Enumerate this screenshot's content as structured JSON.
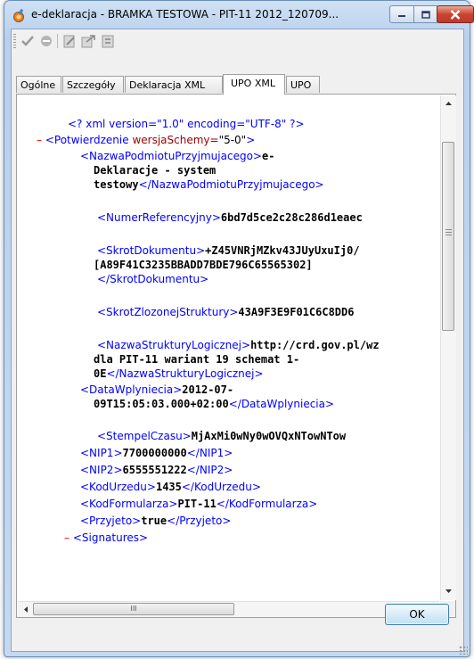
{
  "window": {
    "title": "e-deklaracja - BRAMKA TESTOWA - PIT-11 2012_120709...",
    "controls": {
      "minimize": "minimize",
      "maximize": "maximize",
      "close": "close"
    }
  },
  "toolbar": {
    "icons": [
      "checkmark-icon",
      "no-entry-icon",
      "sign-icon",
      "send-icon",
      "status-icon"
    ]
  },
  "tabs": [
    {
      "label": "Ogólne",
      "active": false
    },
    {
      "label": "Szczegóły",
      "active": false
    },
    {
      "label": "Deklaracja XML",
      "active": false
    },
    {
      "label": "UPO XML",
      "active": true
    },
    {
      "label": "UPO",
      "active": false
    }
  ],
  "xml": {
    "pi": "<? xml version=\"1.0\" encoding=\"UTF-8\" ?>",
    "root_open": "<Potwierdzenie",
    "root_attr_name": " wersjaSchemy=",
    "root_attr_value": "\"5-0\"",
    "root_close_bracket": ">",
    "nazwa_open": "<NazwaPodmiotuPrzyjmujacego>",
    "nazwa_val1": "e-",
    "nazwa_val2": "Deklaracje - system",
    "nazwa_val3": "testowy",
    "nazwa_close": "</NazwaPodmiotuPrzyjmujacego>",
    "numer_open": "<NumerReferencyjny>",
    "numer_val": "6bd7d5ce2c28c286d1eaec",
    "skrot_open": "<SkrotDokumentu>",
    "skrot_val1": "+Z45VNRjMZkv43JUyUxuIj0/",
    "skrot_val2": "[A89F41C3235BBADD7BDE796C65565302]",
    "skrot_close": "</SkrotDokumentu>",
    "skrotz_open": "<SkrotZlozonejStruktury>",
    "skrotz_val": "43A9F3E9F01C6C8DD6",
    "nazwas_open": "<NazwaStrukturyLogicznej>",
    "nazwas_val1": "http://crd.gov.pl/wz",
    "nazwas_val2": "dla PIT-11 wariant 19 schemat 1-",
    "nazwas_val3": "0E",
    "nazwas_close": "</NazwaStrukturyLogicznej>",
    "data_open": "<DataWplyniecia>",
    "data_val1": "2012-07-",
    "data_val2": "09T15:05:03.000+02:00",
    "data_close": "</DataWplyniecia>",
    "stempel_open": "<StempelCzasu>",
    "stempel_val": "MjAxMi0wNy0wOVQxNTowNTow",
    "nip1_open": "<NIP1>",
    "nip1_val": "7700000000",
    "nip1_close": "</NIP1>",
    "nip2_open": "<NIP2>",
    "nip2_val": "6555551222",
    "nip2_close": "</NIP2>",
    "kodu_open": "<KodUrzedu>",
    "kodu_val": "1435",
    "kodu_close": "</KodUrzedu>",
    "kodf_open": "<KodFormularza>",
    "kodf_val": "PIT-11",
    "kodf_close": "</KodFormularza>",
    "przyj_open": "<Przyjeto>",
    "przyj_val": "true",
    "przyj_close": "</Przyjeto>",
    "sig_open": "<Signatures>",
    "dash": "–"
  },
  "scrollbar": {
    "h_thumb_label": "III"
  },
  "buttons": {
    "ok": "OK"
  },
  "colors": {
    "tag": "#0000ff",
    "collapse": "#ff0000",
    "attr_name": "#990000",
    "value": "#000000"
  }
}
